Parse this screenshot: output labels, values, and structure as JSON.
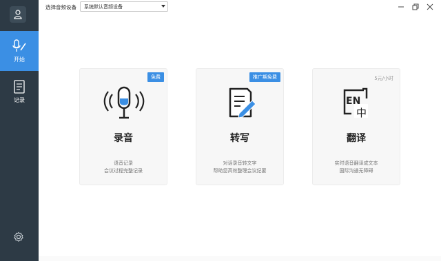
{
  "topbar": {
    "device_label": "选择音频设备",
    "device_value": "系统默认音频设备"
  },
  "sidebar": {
    "items": [
      {
        "label": "开始",
        "icon": "microphone-edit-icon",
        "active": true
      },
      {
        "label": "记录",
        "icon": "document-icon",
        "active": false
      }
    ]
  },
  "cards": [
    {
      "title": "录音",
      "badge": "免费",
      "desc1": "语音记录",
      "desc2": "会议过程完整记录",
      "icon": "microphone-icon"
    },
    {
      "title": "转写",
      "badge": "推广期免费",
      "desc1": "对话录音转文字",
      "desc2": "帮助您高效整理会议纪要",
      "icon": "document-pen-icon"
    },
    {
      "title": "翻译",
      "badge": "5元/小时",
      "desc1": "实时语音翻译成文本",
      "desc2": "国际沟通无障碍",
      "icon": "translate-icon"
    }
  ],
  "colors": {
    "accent": "#3b8fe4",
    "sidebar": "#2d3a45"
  }
}
